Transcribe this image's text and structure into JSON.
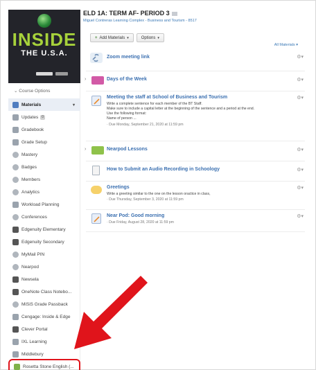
{
  "course": {
    "title": "ELD 1A: TERM AF- PERIOD 3",
    "subtitle": "Miguel Contreras Learning Complex - Business and Tourism - 8517",
    "cover_text": "INSIDE",
    "cover_sub": "THE U.S.A."
  },
  "sidebar": {
    "course_options": "Course Options",
    "items": [
      {
        "label": "Materials",
        "icon": "materials-icon",
        "active": true
      },
      {
        "label": "Updates",
        "icon": "updates-icon",
        "badge": "0"
      },
      {
        "label": "Gradebook",
        "icon": "gradebook-icon"
      },
      {
        "label": "Grade Setup",
        "icon": "grade-setup-icon"
      },
      {
        "label": "Mastery",
        "icon": "mastery-icon"
      },
      {
        "label": "Badges",
        "icon": "badges-icon"
      },
      {
        "label": "Members",
        "icon": "members-icon"
      },
      {
        "label": "Analytics",
        "icon": "analytics-icon"
      },
      {
        "label": "Workload Planning",
        "icon": "workload-icon"
      },
      {
        "label": "Conferences",
        "icon": "conferences-icon"
      },
      {
        "label": "Edgenuity Elementary",
        "icon": "edgenuity-icon"
      },
      {
        "label": "Edgenuity Secondary",
        "icon": "edgenuity-icon"
      },
      {
        "label": "MyMail PIN",
        "icon": "mymail-icon"
      },
      {
        "label": "Nearpod",
        "icon": "nearpod-icon"
      },
      {
        "label": "Newsela",
        "icon": "newsela-icon"
      },
      {
        "label": "OneNote Class Notebo...",
        "icon": "onenote-icon"
      },
      {
        "label": "MiSiS Grade Passback",
        "icon": "misis-icon"
      },
      {
        "label": "Cengage: Inside & Edge",
        "icon": "cengage-icon"
      },
      {
        "label": "Clever Portal",
        "icon": "clever-icon"
      },
      {
        "label": "IXL Learning",
        "icon": "ixl-icon"
      },
      {
        "label": "Middlebury",
        "icon": "middlebury-icon"
      },
      {
        "label": "Rosetta Stone English (...",
        "icon": "rosetta-icon",
        "highlighted": true
      }
    ]
  },
  "toolbar": {
    "add_materials": "Add Materials",
    "options": "Options",
    "all_materials": "All Materials"
  },
  "materials": [
    {
      "title": "Zoom meeting link",
      "type": "link"
    },
    {
      "title": "Days of the Week",
      "type": "folder"
    },
    {
      "title": "Meeting the staff at School of Business and Tourism",
      "type": "assignment",
      "body": [
        "Write a complete sentence for each member of the BT Staff.",
        "Make sure to include a capital letter at the beginning of the sentence and a period at the end.",
        "Use the following format:",
        "Name of person ..."
      ],
      "due": "Due Monday, September 21, 2020 at 11:59 pm"
    },
    {
      "title": "Nearpod Lessons",
      "type": "folder"
    },
    {
      "title": "How to Submit an Audio Recording in Schoology",
      "type": "page"
    },
    {
      "title": "Greetings",
      "type": "discussion",
      "body": [
        "Write a greeting similar to the one on the lesson oractice in class,"
      ],
      "due": "Due Thursday, September 3, 2020 at 11:59 pm"
    },
    {
      "title": "Near Pod: Good morning",
      "type": "assignment",
      "due": "Due Friday, August 28, 2020 at 11:59 pm"
    }
  ],
  "colors": {
    "accent": "#3a6fb0",
    "arrow": "#e0141b",
    "cover_green": "#a7d23b"
  }
}
